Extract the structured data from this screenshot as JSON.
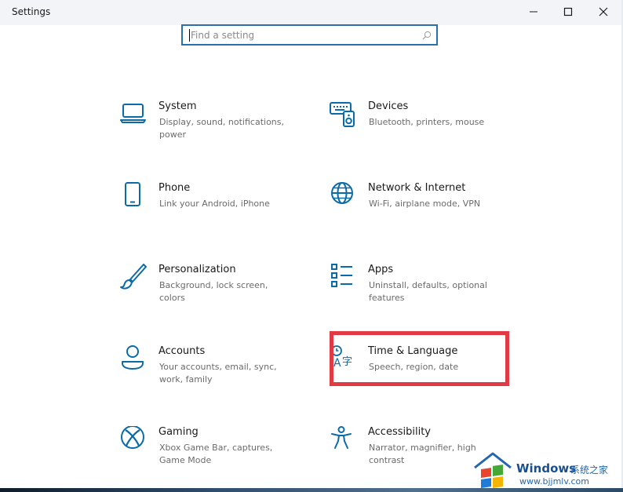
{
  "window": {
    "title": "Settings",
    "controls": [
      "minimize-icon",
      "maximize-icon",
      "close-icon"
    ]
  },
  "search": {
    "placeholder": "Find a setting"
  },
  "tiles": [
    {
      "name": "System",
      "desc": "Display, sound, notifications, power",
      "icon": "laptop-icon"
    },
    {
      "name": "Devices",
      "desc": "Bluetooth, printers, mouse",
      "icon": "keyboard-speaker-icon"
    },
    {
      "name": "Phone",
      "desc": "Link your Android, iPhone",
      "icon": "phone-icon"
    },
    {
      "name": "Network & Internet",
      "desc": "Wi-Fi, airplane mode, VPN",
      "icon": "globe-icon"
    },
    {
      "name": "Personalization",
      "desc": "Background, lock screen, colors",
      "icon": "paintbrush-icon"
    },
    {
      "name": "Apps",
      "desc": "Uninstall, defaults, optional features",
      "icon": "apps-list-icon"
    },
    {
      "name": "Accounts",
      "desc": "Your accounts, email, sync, work, family",
      "icon": "person-icon"
    },
    {
      "name": "Time & Language",
      "desc": "Speech, region, date",
      "icon": "time-language-icon"
    },
    {
      "name": "Gaming",
      "desc": "Xbox Game Bar, captures, Game Mode",
      "icon": "xbox-icon"
    },
    {
      "name": "Accessibility",
      "desc": "Narrator, magnifier, high contrast",
      "icon": "accessibility-icon"
    }
  ],
  "watermark": {
    "brand": "Windows",
    "subtitle": "系统之家",
    "url": "www.bjjmlv.com"
  },
  "colors": {
    "accent": "#0b6ba8",
    "highlight": "#e23a44",
    "search_border": "#2a6fb0"
  }
}
